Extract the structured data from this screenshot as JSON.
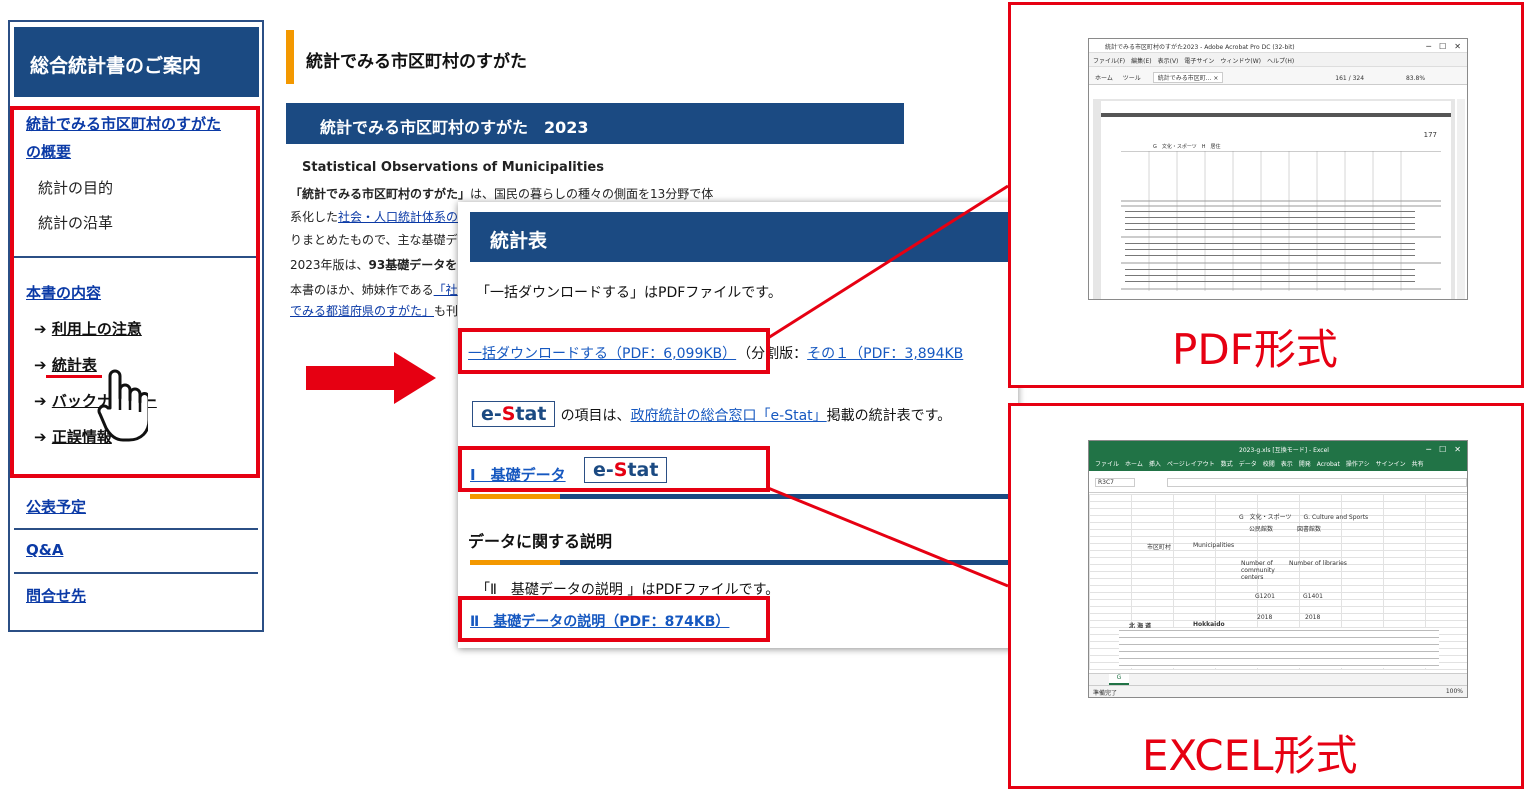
{
  "sidebar": {
    "title": "総合統計書のご案内",
    "overview_line1": "統計でみる市区町村のすがた",
    "overview_line2": "の概要",
    "purpose": "統計の目的",
    "history": "統計の沿革",
    "contents_heading": "本書の内容",
    "items": [
      {
        "arrow": "➔",
        "label": "利用上の注意"
      },
      {
        "arrow": "➔",
        "label": "統計表"
      },
      {
        "arrow": "➔",
        "label": "バックナンバー"
      },
      {
        "arrow": "➔",
        "label": "正誤情報"
      }
    ],
    "schedule": "公表予定",
    "qa": "Q&A",
    "contact": "問合せ先"
  },
  "page": {
    "title": "統計でみる市区町村のすがた",
    "banner": "統計でみる市区町村のすがた　2023",
    "subtitle_en": "Statistical Observations of Municipalities",
    "p1_bold": "「統計でみる市区町村のすがた」",
    "p1_rest": "は、国民の暮らしの種々の側面を13分野で体",
    "p2_pre": "系化した",
    "p2_link": "社会・人口統計体系の",
    "p3": "りまとめたもので、主な基礎デ",
    "p4_pre": "2023年版は、",
    "p4_bold": "93基礎データを",
    "p5_pre": "本書のほか、姉妹作である",
    "p5_link": "「社",
    "p6_link": "でみる都道府県のすがた」",
    "p6_rest": "も刊"
  },
  "overlay": {
    "heading": "統計表",
    "note1": "「一括ダウンロードする」はPDFファイルです。",
    "bulk_link": "一括ダウンロードする（PDF：6,099KB）",
    "split_label": "（分割版：",
    "split_link": "その１（PDF：3,894KB",
    "estat_e": "e-",
    "estat_s": "S",
    "estat_tat": "tat",
    "estat_sentence_pre": "の項目は、",
    "estat_sentence_link": "政府統計の総合窓口「e-Stat」",
    "estat_sentence_post": "掲載の統計表です。",
    "basic_data_link": "Ⅰ　基礎データ",
    "explain_heading": "データに関する説明",
    "note2": "「Ⅱ　基礎データの説明 」はPDFファイルです。",
    "explain_link": "Ⅱ　基礎データの説明（PDF：874KB）"
  },
  "right": {
    "pdf_label": "PDF形式",
    "excel_label": "EXCEL形式",
    "pdf_window": {
      "title": "統計でみる市区町村のすがた2023 - Adobe Acrobat Pro DC (32-bit)",
      "menu": "ファイル(F)　編集(E)　表示(V)　電子サイン　ウィンドウ(W)　ヘルプ(H)",
      "tab_home": "ホーム",
      "tab_tools": "ツール",
      "tab_doc": "統計でみる市区町... ×",
      "page_info": "161 / 324",
      "zoom": "83.8%",
      "page_number": "177",
      "section": "G　文化・スポーツ　H　居住"
    },
    "excel_window": {
      "title": "2023-g.xls [互換モード] - Excel",
      "ribbon": "ファイル　ホーム　挿入　ページレイアウト　数式　データ　校閲　表示　開発　Acrobat　操作アシ　サインイン　共有",
      "cell_ref": "R3C7",
      "sheet_title": "G　文化・スポーツ　　G. Culture and Sports",
      "col_municipality": "市区町村",
      "col_municipalities": "Municipalities",
      "col_community": "公民館数",
      "col_libraries": "図書館数",
      "en_community": "Number of community centers",
      "en_libraries": "Number of libraries",
      "code_1": "G1201",
      "code_2": "G1401",
      "year_1": "2018",
      "year_2": "2018",
      "row_hokkaido": "北 海 道",
      "row_hokkaido_en": "Hokkaido",
      "sheet_tab": "G",
      "status": "準備完了",
      "zoom": "100%"
    }
  }
}
